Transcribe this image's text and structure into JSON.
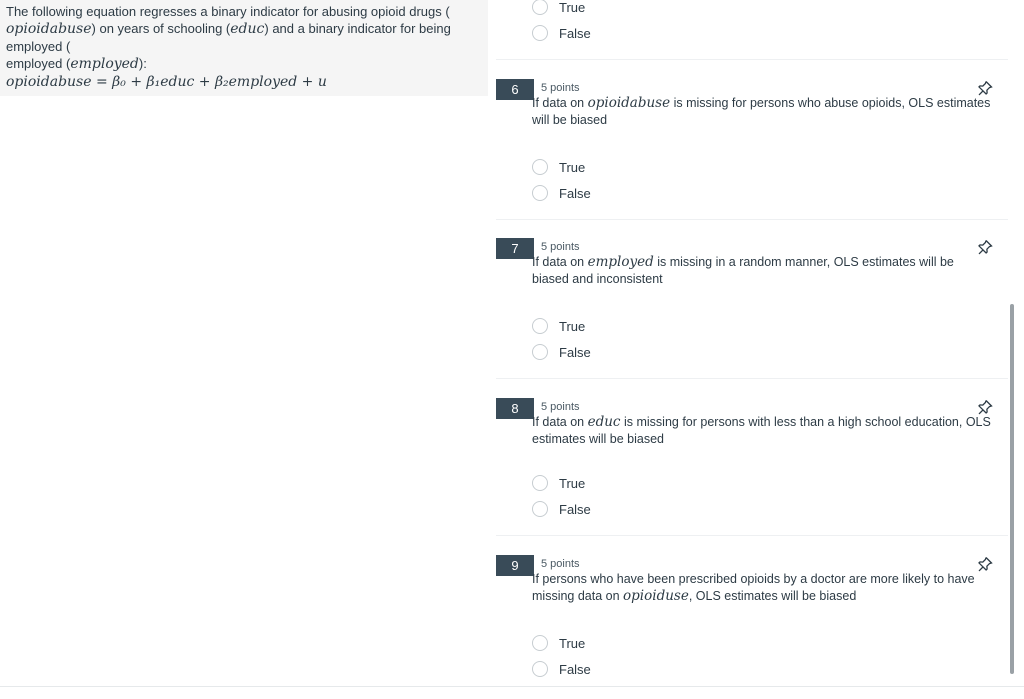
{
  "context": {
    "intro_part1": "The following equation regresses a binary indicator for abusing opioid drugs (",
    "var_opioidabuse": "opioidabuse",
    "intro_part2": ") on years of schooling (",
    "var_educ": "educ",
    "intro_part3": ") and a binary indicator for being employed (",
    "var_employed": "employed",
    "intro_part4": "):",
    "equation": "opioidabuse = β₀ + β₁educ + β₂employed + u"
  },
  "previous_question": {
    "options": [
      "True",
      "False"
    ]
  },
  "questions": [
    {
      "number": "6",
      "points": "5 points",
      "text_before": "If data on ",
      "math": "opioidabuse",
      "text_after": " is missing for persons who abuse opioids, OLS estimates will be biased",
      "options": [
        "True",
        "False"
      ]
    },
    {
      "number": "7",
      "points": "5 points",
      "text_before": "If data on ",
      "math": "employed",
      "text_after": " is missing in a random manner, OLS estimates will be biased and inconsistent",
      "options": [
        "True",
        "False"
      ]
    },
    {
      "number": "8",
      "points": "5 points",
      "text_before": "If data on ",
      "math": "educ",
      "text_after": " is missing for persons with less than a high school education, OLS estimates will be biased",
      "options": [
        "True",
        "False"
      ]
    },
    {
      "number": "9",
      "points": "5 points",
      "text_before": "If persons who have been prescribed opioids by a doctor are more likely to have missing data on ",
      "math": "opioiduse",
      "text_after": ", OLS estimates will be biased",
      "options": [
        "True",
        "False"
      ]
    }
  ],
  "icons": {
    "pin": "pin-icon"
  },
  "colors": {
    "question_number_bg": "#394b58",
    "panel_bg": "#f5f5f5",
    "text": "#2d3b45"
  }
}
